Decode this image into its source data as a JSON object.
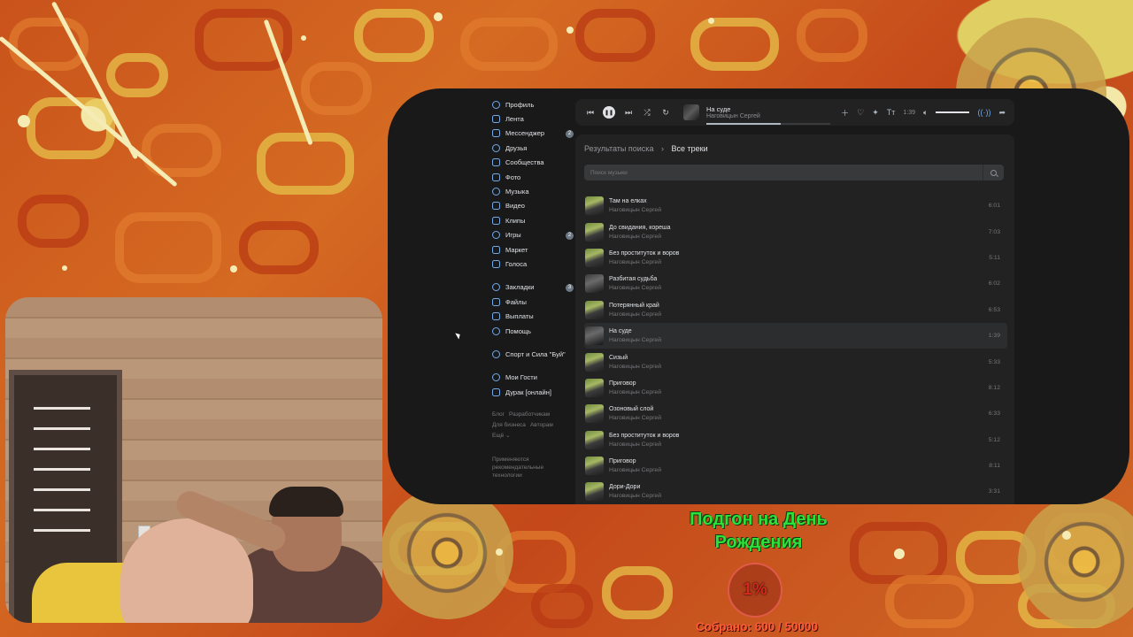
{
  "sidebar": {
    "items": [
      {
        "label": "Профиль",
        "icon": "profile-icon",
        "badge": ""
      },
      {
        "label": "Лента",
        "icon": "news-icon",
        "badge": ""
      },
      {
        "label": "Мессенджер",
        "icon": "messenger-icon",
        "badge": "2"
      },
      {
        "label": "Друзья",
        "icon": "friends-icon",
        "badge": ""
      },
      {
        "label": "Сообщества",
        "icon": "communities-icon",
        "badge": ""
      },
      {
        "label": "Фото",
        "icon": "photo-icon",
        "badge": ""
      },
      {
        "label": "Музыка",
        "icon": "music-icon",
        "badge": ""
      },
      {
        "label": "Видео",
        "icon": "video-icon",
        "badge": ""
      },
      {
        "label": "Клипы",
        "icon": "clips-icon",
        "badge": ""
      },
      {
        "label": "Игры",
        "icon": "games-icon",
        "badge": "2"
      },
      {
        "label": "Маркет",
        "icon": "market-icon",
        "badge": ""
      },
      {
        "label": "Голоса",
        "icon": "votes-icon",
        "badge": ""
      }
    ],
    "items2": [
      {
        "label": "Закладки",
        "icon": "bookmarks-icon",
        "badge": "3"
      },
      {
        "label": "Файлы",
        "icon": "files-icon",
        "badge": ""
      },
      {
        "label": "Выплаты",
        "icon": "payments-icon",
        "badge": ""
      },
      {
        "label": "Помощь",
        "icon": "help-icon",
        "badge": ""
      }
    ],
    "items3": [
      {
        "label": "Спорт и Сила \"Буй\"",
        "icon": "community-avatar-icon",
        "badge": ""
      }
    ],
    "items4": [
      {
        "label": "Мои Гости",
        "icon": "app-guests-icon",
        "badge": ""
      },
      {
        "label": "Дурак [онлайн]",
        "icon": "app-cards-icon",
        "badge": ""
      }
    ],
    "footer_links": [
      "Блог",
      "Разработчикам",
      "Для бизнеса",
      "Авторам",
      "Ещё ⌄"
    ],
    "note": "Применяются рекомендательные технологии"
  },
  "player": {
    "title": "На суде",
    "artist": "Наговицын Сергей",
    "time": "1:39",
    "progress": 0.6,
    "volume": 1.0,
    "controls": [
      "prev-icon",
      "pause-icon",
      "next-icon",
      "shuffle-icon",
      "repeat-icon"
    ],
    "tools": [
      "add-icon",
      "dislike-icon",
      "similar-icon",
      "lyrics-icon",
      "volume-icon",
      "broadcast-icon",
      "share-icon"
    ],
    "tools_text": "Тт"
  },
  "content": {
    "breadcrumb_root": "Результаты поиска",
    "breadcrumb_sep": "›",
    "breadcrumb_current": "Все треки",
    "search_placeholder": "Поиск музыки",
    "tracks": [
      {
        "title": "Там на елках",
        "artist": "Наговицын Сергей",
        "duration": "6:01",
        "active": false
      },
      {
        "title": "До свидания, кореша",
        "artist": "Наговицын Сергей",
        "duration": "7:03",
        "active": false
      },
      {
        "title": "Без проституток и воров",
        "artist": "Наговицын Сергей",
        "duration": "5:11",
        "active": false
      },
      {
        "title": "Разбитая судьба",
        "artist": "Наговицын Сергей",
        "duration": "6:02",
        "active": false
      },
      {
        "title": "Потерянный край",
        "artist": "Наговицын Сергей",
        "duration": "6:53",
        "active": false
      },
      {
        "title": "На суде",
        "artist": "Наговицын Сергей",
        "duration": "1:39",
        "active": true
      },
      {
        "title": "Сизый",
        "artist": "Наговицын Сергей",
        "duration": "5:33",
        "active": false
      },
      {
        "title": "Приговор",
        "artist": "Наговицын Сергей",
        "duration": "8:12",
        "active": false
      },
      {
        "title": "Озоновый слой",
        "artist": "Наговицын Сергей",
        "duration": "6:33",
        "active": false
      },
      {
        "title": "Без проституток и воров",
        "artist": "Наговицын Сергей",
        "duration": "5:12",
        "active": false
      },
      {
        "title": "Приговор",
        "artist": "Наговицын Сергей",
        "duration": "8:11",
        "active": false
      },
      {
        "title": "Дори-Дори",
        "artist": "Наговицын Сергей",
        "duration": "3:31",
        "active": false
      }
    ]
  },
  "overlay": {
    "goal_title": "Подгон на День Рождения",
    "percent": "1%",
    "raised": "Собрано: 600 / 50000",
    "title_color": "#2fe03a",
    "raised_color": "#ff5a3a"
  }
}
